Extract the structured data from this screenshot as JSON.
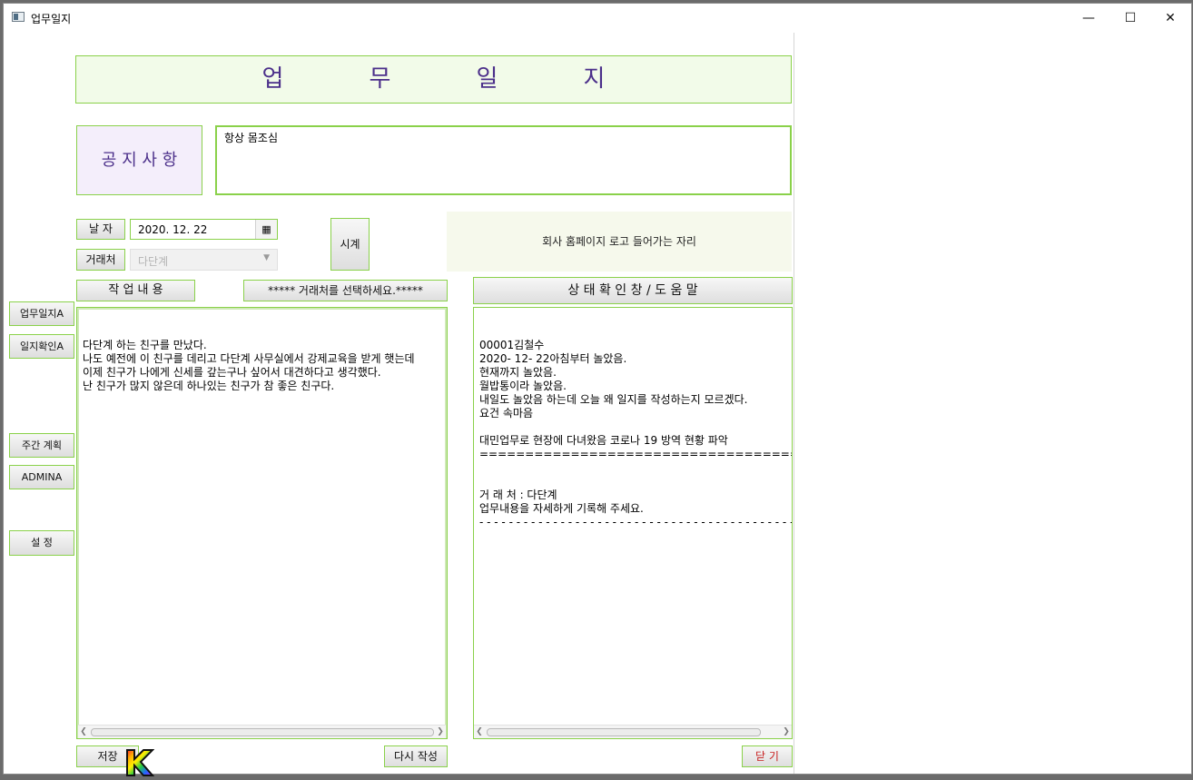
{
  "window": {
    "title": "업무일지"
  },
  "header": {
    "title_chars": [
      "업",
      "무",
      "일",
      "지"
    ]
  },
  "notice": {
    "label": "공 지 사 항",
    "text": "항상 몸조심"
  },
  "form": {
    "date_label": "날  자",
    "date_value": "2020. 12. 22",
    "client_label": "거래처",
    "client_placeholder": "다단계",
    "clock_button": "시계",
    "logo_text": "회사 홈페이지 로고 들어가는 자리"
  },
  "work": {
    "header_label": "작 업 내 용",
    "client_prompt": "***** 거래처를 선택하세요.*****",
    "content": "다단계 하는 친구를 만났다.\n나도 예전에 이 친구를 데리고 다단계 사무실에서 강제교육을 받게 햇는데\n이제 친구가 나에게 신세를 갚는구나 싶어서 대견하다고 생각했다.\n난 친구가 많지 않은데 하나있는 친구가 참 좋은 친구다."
  },
  "status": {
    "header_label": "상 태  확 인 창 /  도 움 말",
    "content": "00001김철수\n2020- 12- 22아침부터 놀았음.\n현재까지 놀았음.\n월밥통이라 놀았음.\n내일도 놀았음 하는데 오늘 왜 일지를 작성하는지 모르겠다.\n요건 속마음\n\n대민업무로 현장에 다녀왔음 코로나 19 방역 현황 파악\n=========================================\n\n\n거 래 처 : 다단계\n업무내용을 자세하게 기록해 주세요.\n- - - - - - - - - - - - - - - - - - - - - - - - - - - - - - - - - - - - - - - - - - - -"
  },
  "sidebar": {
    "items": [
      {
        "label": "업무일지A"
      },
      {
        "label": "일지확인A"
      },
      {
        "label": "주간 계획"
      },
      {
        "label": "ADMINA"
      },
      {
        "label": "설   정"
      }
    ]
  },
  "footer": {
    "save_label": "저장",
    "rewrite_label": "다시 작성",
    "close_label": "닫   기"
  },
  "colors": {
    "accent_border": "#8ad14a",
    "title_text": "#4b2f8a",
    "close_text": "#c81e1e"
  }
}
